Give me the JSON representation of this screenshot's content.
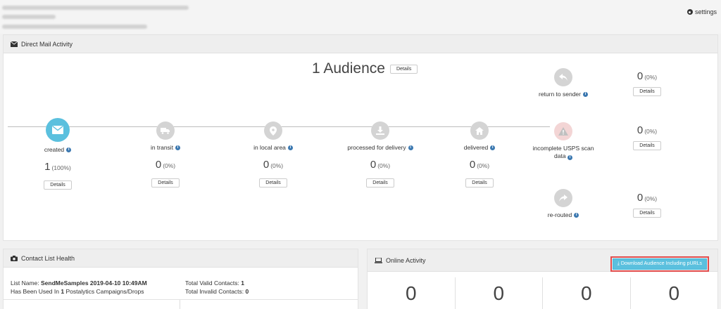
{
  "header": {
    "settings_label": "settings"
  },
  "direct_mail": {
    "panel_title": "Direct Mail Activity",
    "audience_count": "1 Audience",
    "audience_details": "Details",
    "stages": [
      {
        "name": "created",
        "count": "1",
        "pct": "(100%)",
        "details": "Details"
      },
      {
        "name": "in transit",
        "count": "0",
        "pct": "(0%)",
        "details": "Details"
      },
      {
        "name": "in local area",
        "count": "0",
        "pct": "(0%)",
        "details": "Details"
      },
      {
        "name": "processed for delivery",
        "count": "0",
        "pct": "(0%)",
        "details": "Details"
      },
      {
        "name": "delivered",
        "count": "0",
        "pct": "(0%)",
        "details": "Details"
      }
    ],
    "side_stages": [
      {
        "name": "return to sender",
        "count": "0",
        "pct": "(0%)",
        "details": "Details"
      },
      {
        "name": "incomplete USPS scan data",
        "count": "0",
        "pct": "(0%)",
        "details": "Details"
      },
      {
        "name": "re-routed",
        "count": "0",
        "pct": "(0%)",
        "details": "Details"
      }
    ]
  },
  "contact_health": {
    "panel_title": "Contact List Health",
    "list_name_label": "List Name:",
    "list_name_value": "SendMeSamples 2019-04-10 10:49AM",
    "used_prefix": "Has Been Used In",
    "used_count": "1",
    "used_suffix": "Postalytics Campaigns/Drops",
    "valid_label": "Total Valid Contacts:",
    "valid_value": "1",
    "invalid_label": "Total Invalid Contacts:",
    "invalid_value": "0"
  },
  "online_activity": {
    "panel_title": "Online Activity",
    "download_label": "Download Audience Including pURLs",
    "values": [
      "0",
      "0",
      "0",
      "0"
    ]
  },
  "colors": {
    "accent": "#5bc0de",
    "info": "#3b78b0",
    "highlight_border": "#e24e4e"
  }
}
